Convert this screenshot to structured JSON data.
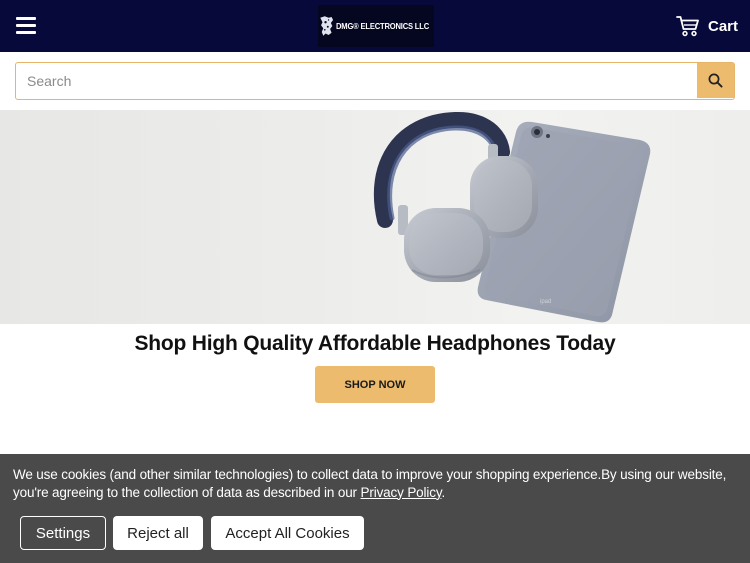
{
  "header": {
    "logo_text": "DMG® ELECTRONICS LLC",
    "cart_label": "Cart"
  },
  "search": {
    "placeholder": "Search",
    "value": ""
  },
  "hero": {
    "headline": "Shop High Quality Affordable Headphones Today",
    "cta_label": "SHOP NOW"
  },
  "cookie_banner": {
    "text": "We use cookies (and other similar technologies) to collect data to improve your shopping experience.By using our website, you're agreeing to the collection of data as described in our ",
    "link_label": "Privacy Policy",
    "after_link": ".",
    "buttons": {
      "settings": "Settings",
      "reject": "Reject all",
      "accept": "Accept All Cookies"
    }
  },
  "colors": {
    "header_bg": "#06093a",
    "accent": "#edbb6e",
    "cookie_bg": "#4a4a4a"
  },
  "icons": [
    "hamburger-menu-icon",
    "cart-icon",
    "search-icon"
  ]
}
